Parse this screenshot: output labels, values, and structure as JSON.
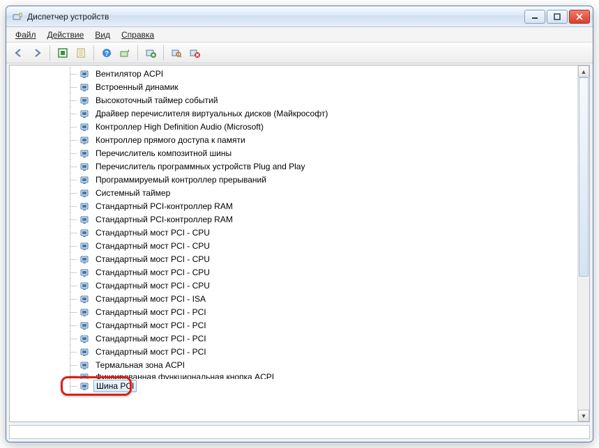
{
  "window": {
    "title": "Диспетчер устройств"
  },
  "menu": {
    "file": "Файл",
    "action": "Действие",
    "view": "Вид",
    "help": "Справка"
  },
  "toolbar_icons": {
    "back": "back-arrow",
    "forward": "forward-arrow",
    "show_hidden": "show-hidden",
    "properties": "properties",
    "help": "help",
    "update": "update",
    "uninstall": "uninstall",
    "scan": "scan-hardware",
    "remove": "remove-device"
  },
  "devices": [
    {
      "label": "Вентилятор ACPI"
    },
    {
      "label": "Встроенный динамик"
    },
    {
      "label": "Высокоточный таймер событий"
    },
    {
      "label": "Драйвер перечислителя виртуальных дисков (Майкрософт)"
    },
    {
      "label": "Контроллер High Definition Audio (Microsoft)"
    },
    {
      "label": "Контроллер прямого доступа к памяти"
    },
    {
      "label": "Перечислитель композитной шины"
    },
    {
      "label": "Перечислитель программных устройств Plug and Play"
    },
    {
      "label": "Программируемый контроллер прерываний"
    },
    {
      "label": "Системный таймер"
    },
    {
      "label": "Стандартный PCI-контроллер RAM"
    },
    {
      "label": "Стандартный PCI-контроллер RAM"
    },
    {
      "label": "Стандартный мост PCI  - CPU"
    },
    {
      "label": "Стандартный мост PCI  - CPU"
    },
    {
      "label": "Стандартный мост PCI  - CPU"
    },
    {
      "label": "Стандартный мост PCI  - CPU"
    },
    {
      "label": "Стандартный мост PCI  - CPU"
    },
    {
      "label": "Стандартный мост PCI - ISA"
    },
    {
      "label": "Стандартный мост PCI - PCI"
    },
    {
      "label": "Стандартный мост PCI - PCI"
    },
    {
      "label": "Стандартный мост PCI - PCI"
    },
    {
      "label": "Стандартный мост PCI - PCI"
    },
    {
      "label": "Термальная зона ACPI"
    },
    {
      "label": "Фиксированная функциональная кнопка ACPI",
      "partial": true
    },
    {
      "label": "Шина PCI",
      "selected": true,
      "highlighted": true
    }
  ]
}
